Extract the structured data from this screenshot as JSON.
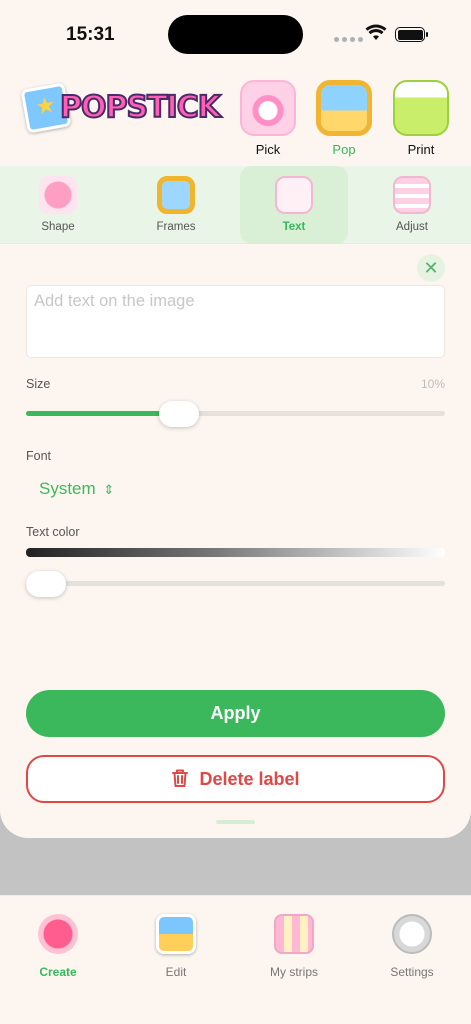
{
  "status_bar": {
    "time": "15:31"
  },
  "header": {
    "logo_text": "POPSTICK",
    "modes": [
      {
        "label": "Pick",
        "icon": "camera-icon",
        "active": false
      },
      {
        "label": "Pop",
        "icon": "photo-frame-icon",
        "active": true
      },
      {
        "label": "Print",
        "icon": "printer-icon",
        "active": false
      }
    ]
  },
  "tools": [
    {
      "label": "Shape",
      "icon": "heart-icon"
    },
    {
      "label": "Frames",
      "icon": "frame-icon"
    },
    {
      "label": "Text",
      "icon": "text-icon",
      "active": true
    },
    {
      "label": "Adjust",
      "icon": "sliders-icon"
    }
  ],
  "editor": {
    "text_placeholder": "Add text on the image",
    "size_label": "Size",
    "size_value": "10%",
    "size_fraction": 0.35,
    "font_label": "Font",
    "font_value": "System",
    "color_label": "Text color",
    "color_fraction": 0.0,
    "apply_label": "Apply",
    "delete_label": "Delete label"
  },
  "tabbar": [
    {
      "label": "Create",
      "icon": "plus-icon",
      "active": true
    },
    {
      "label": "Edit",
      "icon": "photos-icon"
    },
    {
      "label": "My strips",
      "icon": "strips-icon"
    },
    {
      "label": "Settings",
      "icon": "settings-cloud-icon"
    }
  ],
  "colors": {
    "accent": "#3cb85c",
    "danger": "#e04848",
    "background": "#fdf6f0"
  }
}
